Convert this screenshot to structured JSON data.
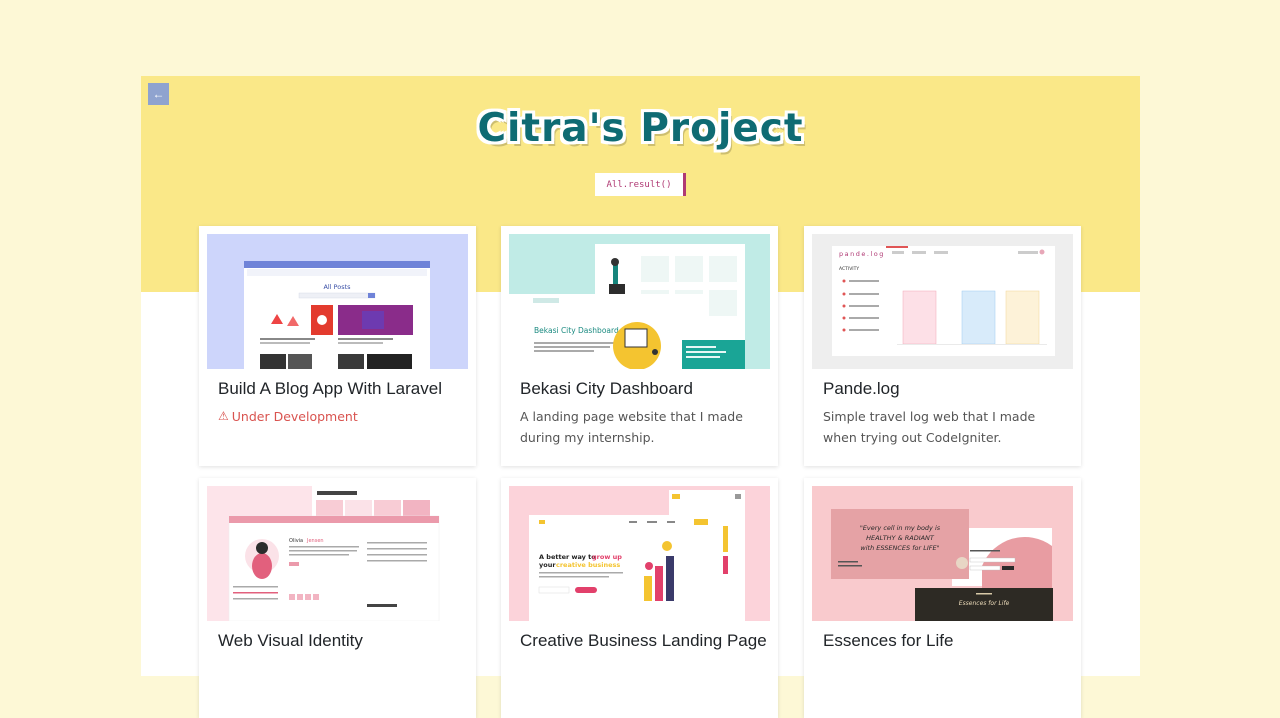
{
  "header": {
    "title": "Citra's Project",
    "filter_label": "All.result()",
    "back_icon": "arrow-left-icon"
  },
  "colors": {
    "page_bg": "#fdf8d6",
    "banner_bg": "#fae888",
    "title": "#0e6b73",
    "accent": "#b03a74",
    "warning": "#d9534f"
  },
  "projects": [
    {
      "title": "Build A Blog App With Laravel",
      "status": "Under Development",
      "thumb": {
        "heading": "All Posts"
      }
    },
    {
      "title": "Bekasi City Dashboard",
      "description": "A landing page website that I made during my internship.",
      "thumb": {
        "heading": "Bekasi City Dashboard"
      }
    },
    {
      "title": "Pande.log",
      "description": "Simple travel log web that I made when trying out CodeIgniter.",
      "thumb": {
        "logo": "pande.log",
        "label": "ACTIVITY"
      }
    },
    {
      "title": "Web Visual Identity",
      "thumb": {
        "heading": "Olivia",
        "heading2": "Jensen"
      }
    },
    {
      "title": "Creative Business Landing Page",
      "thumb": {
        "line1": "A better way to",
        "line1b": "grow up",
        "line2": "your",
        "line2b": "creative business"
      }
    },
    {
      "title": "Essences for Life",
      "thumb": {
        "quote1": "\"Every cell in my body is",
        "quote2": "HEALTHY & RADIANT",
        "quote3": "with ESSENCES for LIFE\"",
        "footer": "Essences for Life"
      }
    }
  ]
}
